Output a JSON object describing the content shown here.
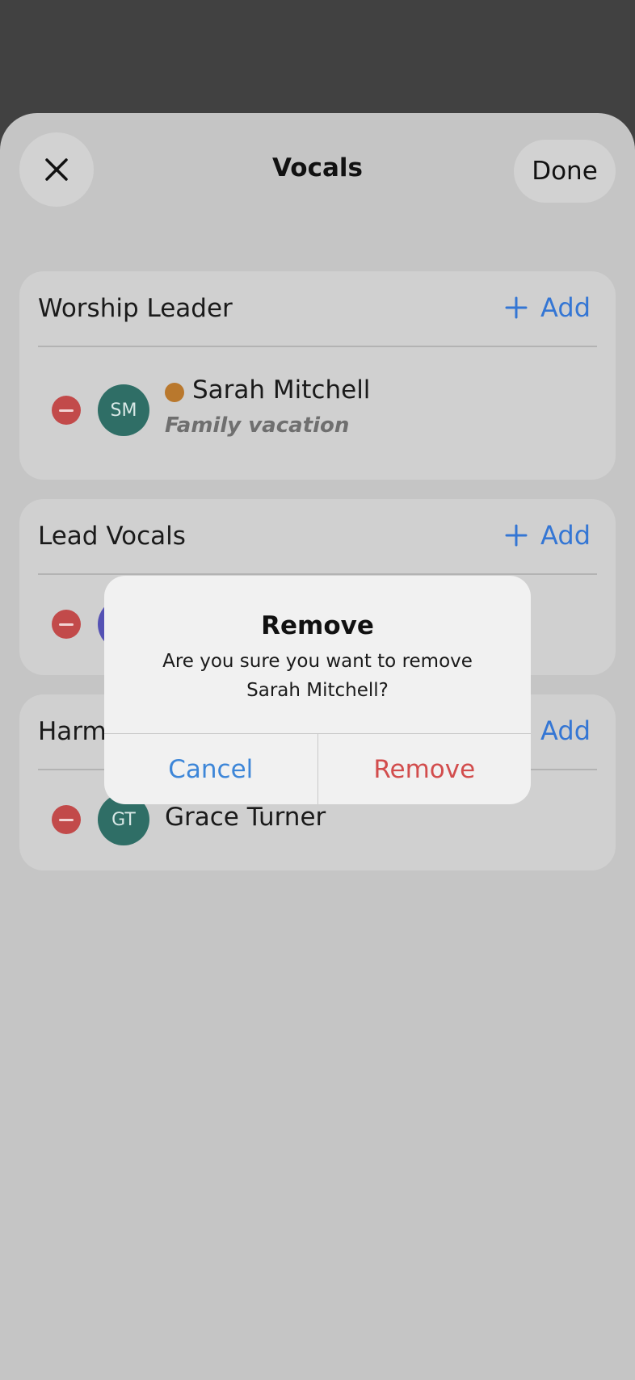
{
  "header": {
    "title": "Vocals",
    "close_icon": "close-icon",
    "done_label": "Done"
  },
  "sections": [
    {
      "title": "Worship Leader",
      "add_label": "Add",
      "members": [
        {
          "initials": "SM",
          "name": "Sarah Mitchell",
          "note": "Family vacation",
          "avatar_color": "#2f6e66",
          "status_color": "#b9782d"
        }
      ]
    },
    {
      "title": "Lead Vocals",
      "add_label": "Add",
      "members": [
        {
          "initials": "",
          "name": "",
          "avatar_color": "#5552b4"
        }
      ]
    },
    {
      "title": "Harm",
      "add_label": "Add",
      "members": [
        {
          "initials": "GT",
          "name": "Grace Turner",
          "avatar_color": "#2f6e66"
        }
      ]
    }
  ],
  "dialog": {
    "title": "Remove",
    "message": "Are you sure you want to remove Sarah Mitchell?",
    "cancel_label": "Cancel",
    "confirm_label": "Remove"
  },
  "colors": {
    "accent": "#3476d4",
    "destructive": "#d24d4d"
  }
}
